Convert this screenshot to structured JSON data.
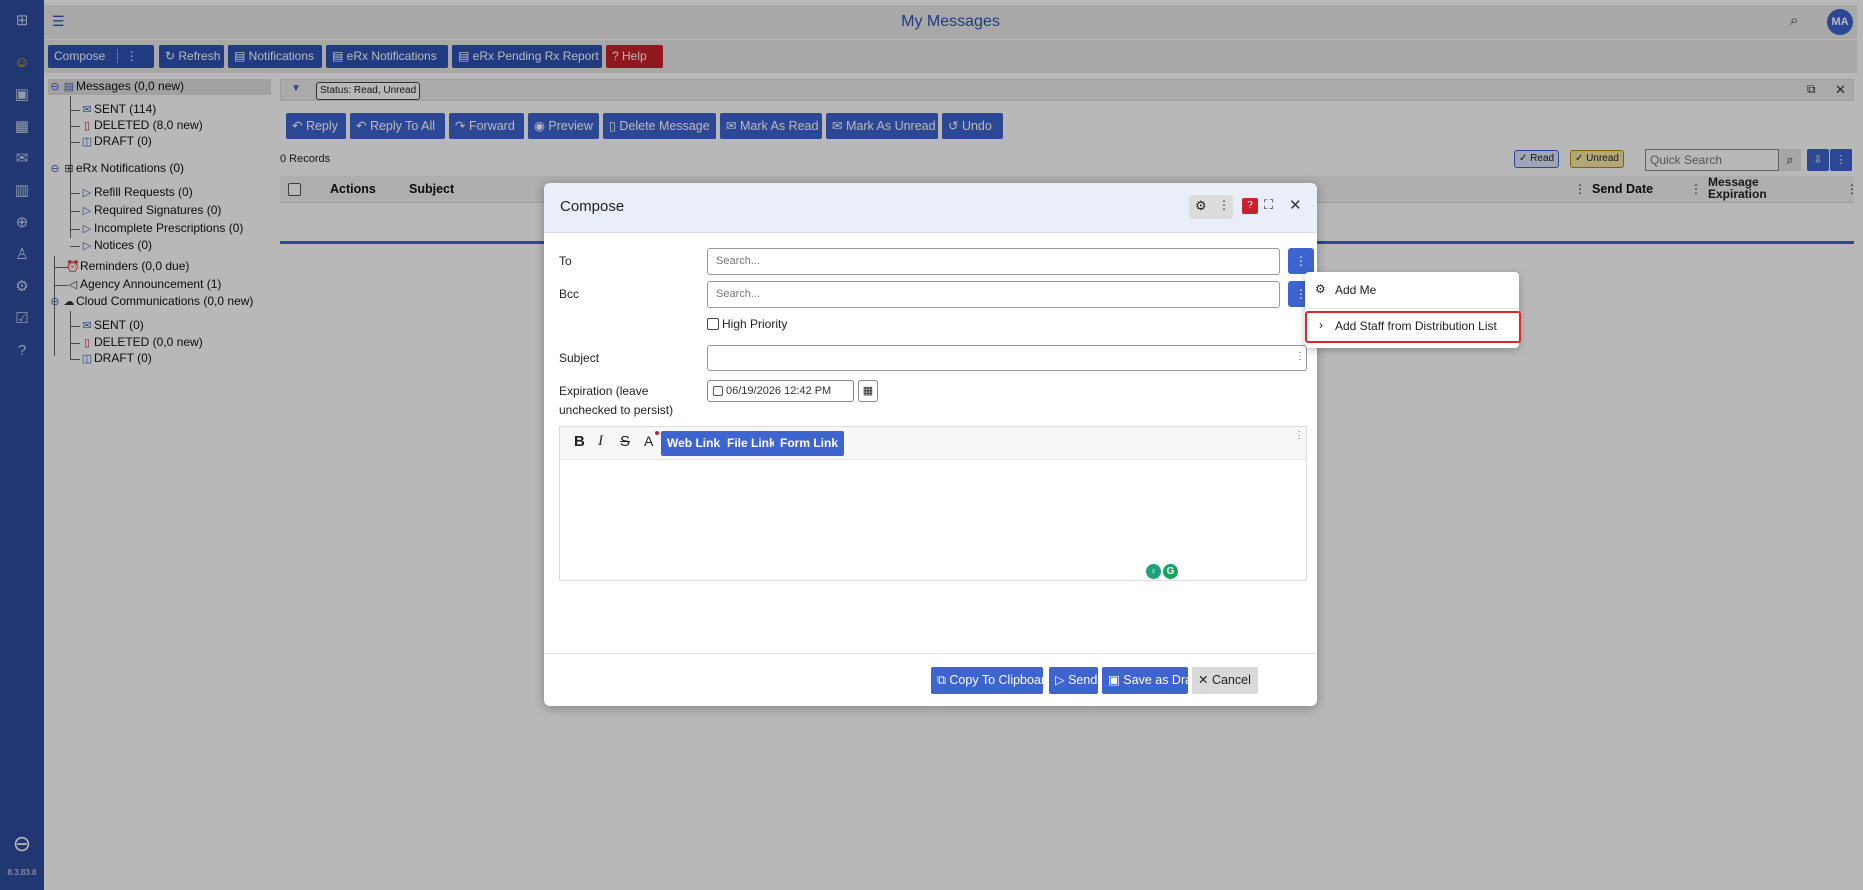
{
  "app": {
    "title": "My Messages",
    "version": "8.3.83.8",
    "avatar": "MA"
  },
  "toolbar": {
    "compose": "Compose",
    "more": "⋮",
    "refresh": "Refresh",
    "notifications": "Notifications",
    "erx_notifications": "eRx Notifications",
    "erx_pending": "eRx Pending Rx Report",
    "help": "Help"
  },
  "tree": {
    "messages": "Messages (0,0 new)",
    "sent": "SENT (114)",
    "deleted": "DELETED (8,0 new)",
    "draft": "DRAFT (0)",
    "erx": "eRx Notifications (0)",
    "refill": "Refill Requests (0)",
    "required_sig": "Required Signatures (0)",
    "incomplete": "Incomplete Prescriptions (0)",
    "notices": "Notices (0)",
    "reminders": "Reminders (0,0 due)",
    "announcement": "Agency Announcement (1)",
    "cloud": "Cloud Communications (0,0 new)",
    "cloud_sent": "SENT (0)",
    "cloud_deleted": "DELETED (0,0 new)",
    "cloud_draft": "DRAFT (0)"
  },
  "filter": {
    "chip": "Status: Read, Unread"
  },
  "actions": {
    "reply": "Reply",
    "reply_all": "Reply To All",
    "forward": "Forward",
    "preview": "Preview",
    "delete": "Delete Message",
    "mark_read": "Mark As Read",
    "mark_unread": "Mark As Unread",
    "undo": "Undo"
  },
  "records": {
    "count": "0 Records",
    "read_chip": "✓ Read",
    "unread_chip": "✓ Unread",
    "quick_search_placeholder": "Quick Search"
  },
  "grid": {
    "col_actions": "Actions",
    "col_subject": "Subject",
    "col_send_date": "Send Date",
    "col_expiration_1": "Message",
    "col_expiration_2": "Expiration"
  },
  "compose": {
    "title": "Compose",
    "to_label": "To",
    "to_placeholder": "Search...",
    "bcc_label": "Bcc",
    "bcc_placeholder": "Search...",
    "high_priority": "High Priority",
    "subject_label": "Subject",
    "expiration_label_1": "Expiration (leave",
    "expiration_label_2": "unchecked to persist)",
    "expiration_value": "06/19/2026 12:42 PM",
    "bold": "B",
    "italic": "I",
    "strike": "S",
    "font_color": "A",
    "web_link": "Web Link",
    "file_link": "File Link",
    "form_link": "Form Link",
    "copy_clipboard": "Copy To Clipboard",
    "send": "Send",
    "save_draft": "Save as Draft",
    "cancel": "Cancel"
  },
  "popup": {
    "add_me": "Add Me",
    "add_staff": "Add Staff from Distribution List"
  },
  "colors": {
    "accent": "#3e64cf",
    "nav": "#2d4d9e",
    "danger": "#c8232c",
    "highlight": "#e0252b"
  }
}
